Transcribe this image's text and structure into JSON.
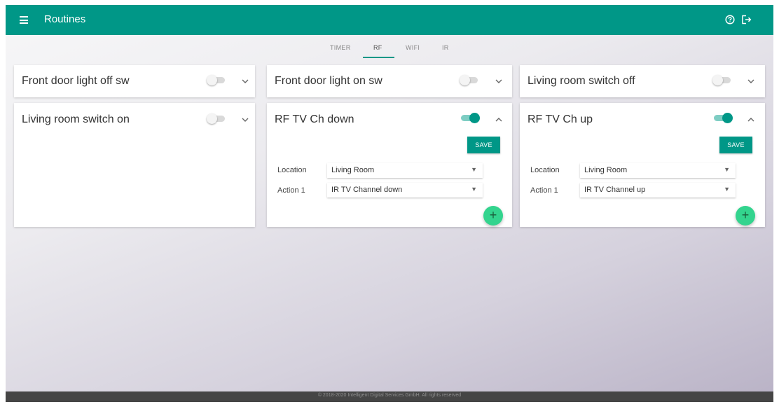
{
  "header": {
    "title": "Routines",
    "menu_icon": "hamburger-menu-icon",
    "help_icon": "help-circle-icon",
    "logout_icon": "logout-icon",
    "color": "#009787"
  },
  "tabs": [
    {
      "label": "TIMER",
      "active": false
    },
    {
      "label": "RF",
      "active": true
    },
    {
      "label": "WIFI",
      "active": false
    },
    {
      "label": "IR",
      "active": false
    }
  ],
  "routines": [
    {
      "title": "Front door light off sw",
      "enabled": false,
      "expanded": false
    },
    {
      "title": "Front door light on sw",
      "enabled": false,
      "expanded": false
    },
    {
      "title": "Living room switch off",
      "enabled": false,
      "expanded": false
    },
    {
      "title": "Living room switch on",
      "enabled": false,
      "expanded": false
    },
    {
      "title": "RF TV Ch down",
      "enabled": true,
      "expanded": true,
      "save_label": "SAVE",
      "fields": [
        {
          "label": "Location",
          "value": "Living Room"
        },
        {
          "label": "Action 1",
          "value": "IR TV Channel down"
        }
      ],
      "add_label": "+"
    },
    {
      "title": "RF TV Ch up",
      "enabled": true,
      "expanded": true,
      "save_label": "SAVE",
      "fields": [
        {
          "label": "Location",
          "value": "Living Room"
        },
        {
          "label": "Action 1",
          "value": "IR TV Channel up"
        }
      ],
      "add_label": "+"
    }
  ],
  "select_caret": "▼",
  "footer": {
    "text": "© 2018-2020 Intelligent Digital Services GmbH. All rights reserved"
  },
  "colors": {
    "accent": "#009787",
    "fab": "#33d48e",
    "footer": "#454545"
  }
}
